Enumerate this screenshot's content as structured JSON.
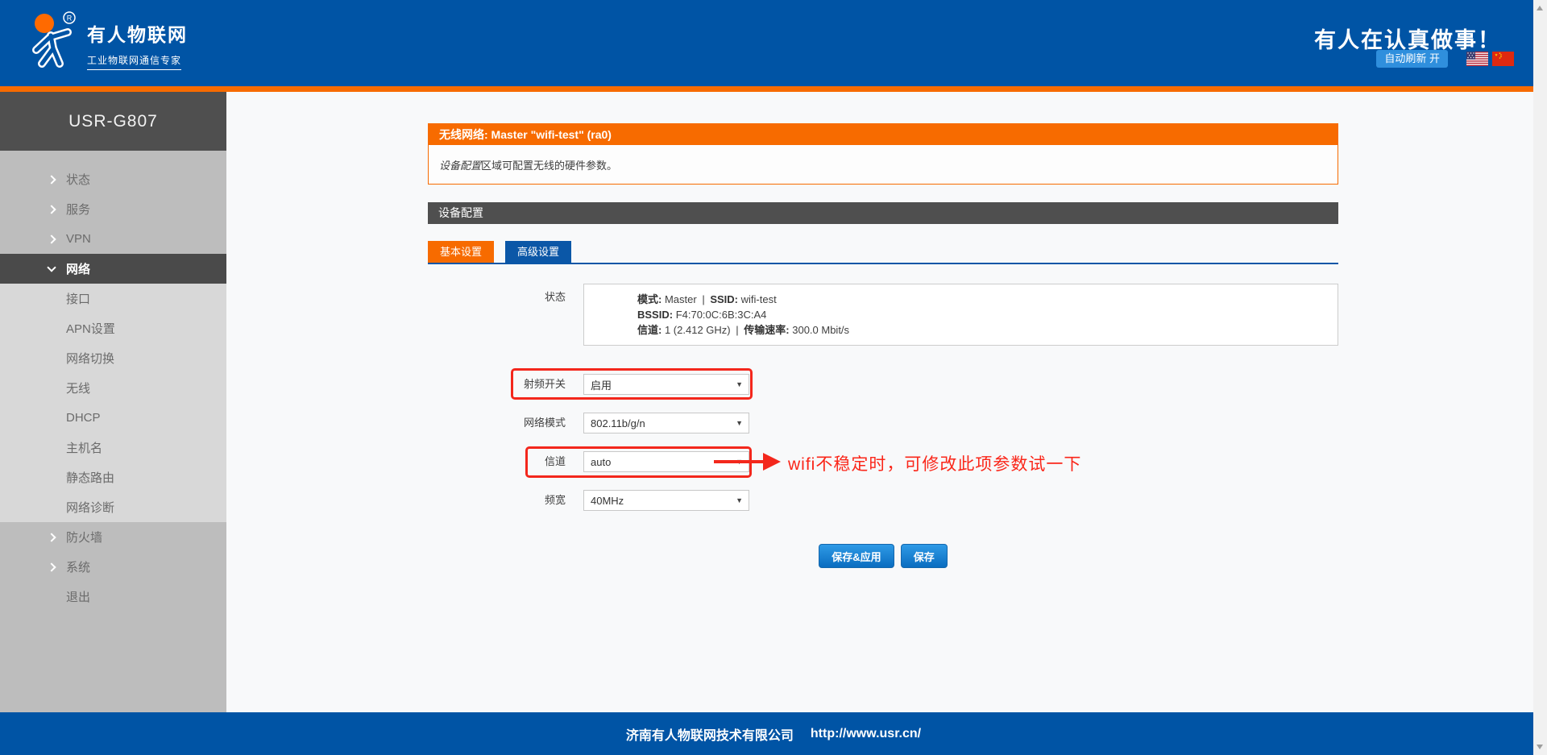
{
  "header": {
    "brand_name": "有人物联网",
    "brand_tagline": "工业物联网通信专家",
    "registered_mark": "R",
    "slogan": "有人在认真做事！",
    "auto_refresh_label": "自动刷新 开"
  },
  "sidebar": {
    "device_name": "USR-G807",
    "items": [
      {
        "label": "状态"
      },
      {
        "label": "服务"
      },
      {
        "label": "VPN"
      },
      {
        "label": "网络"
      },
      {
        "label": "接口"
      },
      {
        "label": "APN设置"
      },
      {
        "label": "网络切换"
      },
      {
        "label": "无线"
      },
      {
        "label": "DHCP"
      },
      {
        "label": "主机名"
      },
      {
        "label": "静态路由"
      },
      {
        "label": "网络诊断"
      },
      {
        "label": "防火墙"
      },
      {
        "label": "系统"
      },
      {
        "label": "退出"
      }
    ]
  },
  "panel": {
    "title": "无线网络: Master \"wifi-test\" (ra0)",
    "description_italic": "设备配置",
    "description_rest": "区域可配置无线的硬件参数。",
    "section_title": "设备配置",
    "tabs": [
      {
        "label": "基本设置"
      },
      {
        "label": "高级设置"
      }
    ]
  },
  "form": {
    "status_label": "状态",
    "status": {
      "mode_label": "模式:",
      "mode_value": "Master",
      "sep": "|",
      "ssid_label": "SSID:",
      "ssid_value": "wifi-test",
      "bssid_label": "BSSID:",
      "bssid_value": "F4:70:0C:6B:3C:A4",
      "channel_label": "信道:",
      "channel_value": "1 (2.412 GHz)",
      "rate_label": "传输速率:",
      "rate_value": "300.0 Mbit/s"
    },
    "fields": [
      {
        "label": "射频开关",
        "value": "启用"
      },
      {
        "label": "网络模式",
        "value": "802.11b/g/n"
      },
      {
        "label": "信道",
        "value": "auto",
        "annotation": "wifi不稳定时，可修改此项参数试一下"
      },
      {
        "label": "频宽",
        "value": "40MHz"
      }
    ],
    "buttons": {
      "save_apply": "保存&应用",
      "save": "保存"
    }
  },
  "footer": {
    "company": "济南有人物联网技术有限公司",
    "url": "http://www.usr.cn/"
  },
  "colors": {
    "accent_orange": "#f76b00",
    "brand_blue": "#0054a5",
    "tab_blue": "#0b57a7",
    "annotation_red": "#f3271c",
    "sidebar_dark": "#4f4f4f",
    "button_blue_top": "#2e9ae6",
    "button_blue_bottom": "#0a6dc0"
  }
}
